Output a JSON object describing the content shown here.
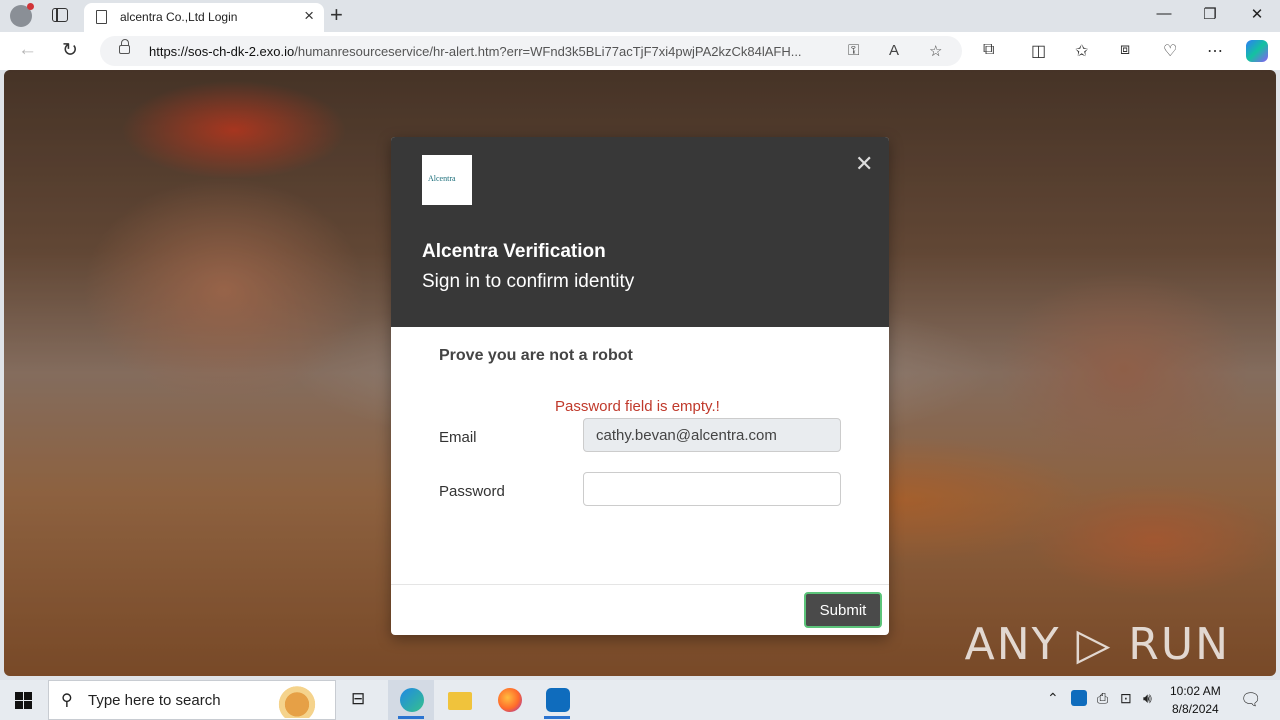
{
  "browser": {
    "tab_title": "alcentra Co.,Ltd Login",
    "url_host": "https://sos-ch-dk-2.exo.io",
    "url_rest": "/humanresourceservice/hr-alert.htm?err=WFnd3k5BLi77acTjF7xi4pwjPA2kzCk84lAFH...",
    "icons": [
      "profile-icon",
      "tabs-icon",
      "page-icon",
      "close-icon",
      "plus-icon",
      "back-icon",
      "refresh-icon",
      "lock-icon",
      "key-icon",
      "read-aloud-icon",
      "star-icon",
      "extensions-icon",
      "split-screen-icon",
      "favorites-icon",
      "collections-icon",
      "browser-essentials-icon",
      "more-icon",
      "copilot-icon"
    ]
  },
  "modal": {
    "logo_text": "Alcentra",
    "title": "Alcentra Verification",
    "subtitle": "Sign in to confirm identity",
    "section_title": "Prove you are not a robot",
    "error": "Password field is empty.!",
    "email_label": "Email",
    "email_value": "cathy.bevan@alcentra.com",
    "password_label": "Password",
    "password_value": "",
    "submit_label": "Submit"
  },
  "watermark": "ANY ▷ RUN",
  "taskbar": {
    "search_placeholder": "Type here to search",
    "time": "10:02 AM",
    "date": "8/8/2024",
    "accent": "#2b74d0"
  },
  "colors": {
    "modal_header": "#383838",
    "error_text": "#c0392b",
    "submit_bg": "#4a4a4a",
    "submit_border": "#5cc47a"
  }
}
